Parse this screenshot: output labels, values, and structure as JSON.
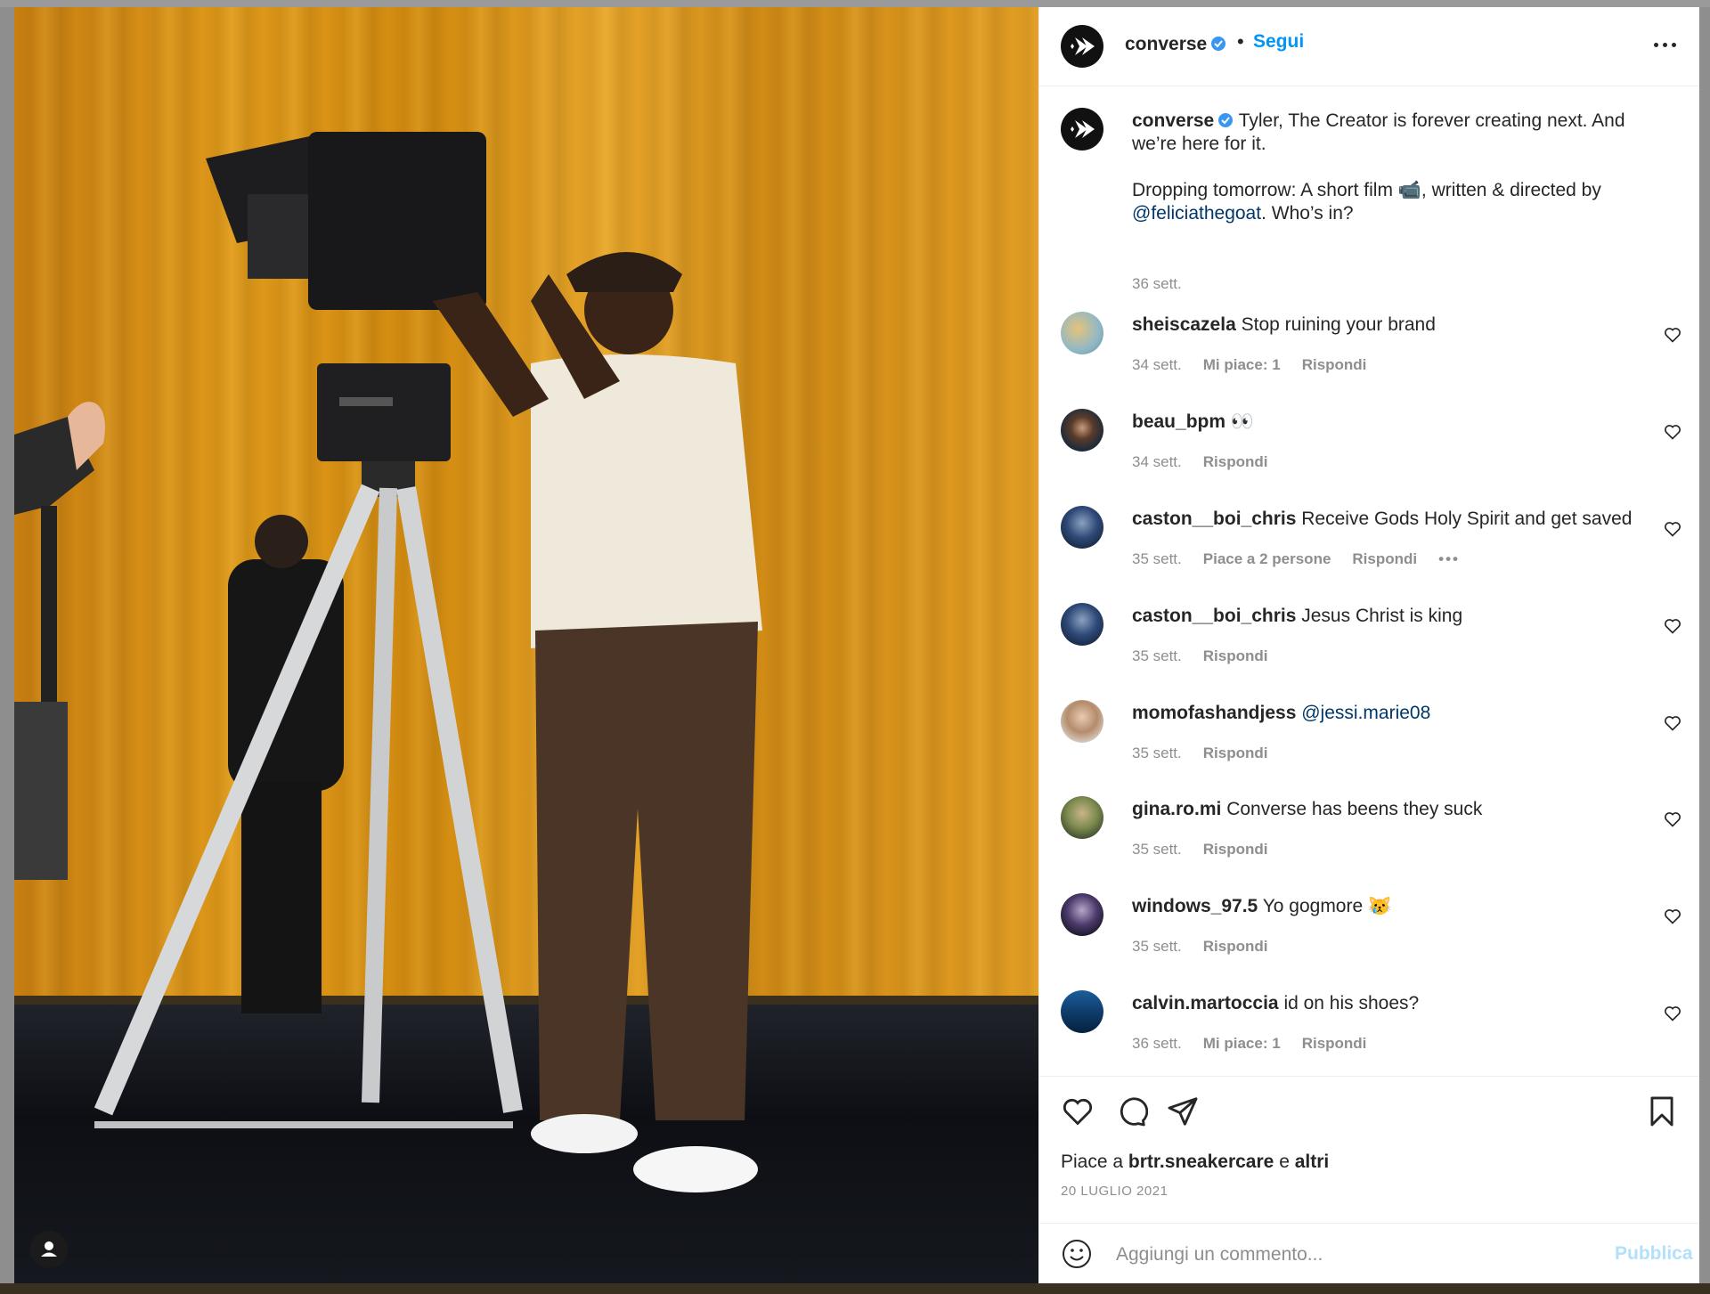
{
  "header": {
    "username": "converse",
    "separator": "•",
    "follow_label": "Segui"
  },
  "caption": {
    "username": "converse",
    "text_line1": "Tyler, The Creator is forever creating next. And we’re here for it.",
    "text_line2_prefix": "Dropping tomorrow: A short film 📹, written & directed by",
    "mention": "@feliciathegoat",
    "text_line2_suffix": ". Who’s in?",
    "time": "36 sett."
  },
  "comments": [
    {
      "username": "sheiscazela",
      "text": "Stop ruining your brand",
      "time": "34 sett.",
      "likes": "Mi piace: 1",
      "reply": "Rispondi",
      "more": ""
    },
    {
      "username": "beau_bpm",
      "text": "👀",
      "time": "34 sett.",
      "likes": "",
      "reply": "Rispondi",
      "more": ""
    },
    {
      "username": "caston__boi_chris",
      "text": "Receive Gods Holy Spirit and get saved",
      "time": "35 sett.",
      "likes": "Piace a 2 persone",
      "reply": "Rispondi",
      "more": "•••"
    },
    {
      "username": "caston__boi_chris",
      "text": "Jesus Christ is king",
      "time": "35 sett.",
      "likes": "",
      "reply": "Rispondi",
      "more": ""
    },
    {
      "username": "momofashandjess",
      "text": "",
      "mention": "@jessi.marie08",
      "time": "35 sett.",
      "likes": "",
      "reply": "Rispondi",
      "more": ""
    },
    {
      "username": "gina.ro.mi",
      "text": "Converse has beens they suck",
      "time": "35 sett.",
      "likes": "",
      "reply": "Rispondi",
      "more": ""
    },
    {
      "username": "windows_97.5",
      "text": "Yo gogmore 😿",
      "time": "35 sett.",
      "likes": "",
      "reply": "Rispondi",
      "more": ""
    },
    {
      "username": "calvin.martoccia",
      "text": "id on his shoes?",
      "time": "36 sett.",
      "likes": "Mi piace: 1",
      "reply": "Rispondi",
      "more": ""
    }
  ],
  "likes": {
    "prefix": "Piace a",
    "user": "brtr.sneakercare",
    "conj": "e",
    "others": "altri"
  },
  "post_date": "20 LUGLIO 2021",
  "add_comment": {
    "placeholder": "Aggiungi un commento...",
    "publish_label": "Pubblica"
  },
  "colors": {
    "accent": "#0095f6",
    "publish_disabled": "#b2dffc",
    "mention": "#00376b",
    "secondary_text": "#8e8e8e",
    "verified": "#3897f0"
  },
  "icons": {
    "header": [
      "converse-logo-icon",
      "verified-badge-icon",
      "more-options-icon"
    ],
    "actions": [
      "heart-icon",
      "comment-icon",
      "share-icon",
      "bookmark-icon"
    ],
    "input": [
      "emoji-icon"
    ],
    "photo": [
      "user-tag-icon"
    ]
  }
}
